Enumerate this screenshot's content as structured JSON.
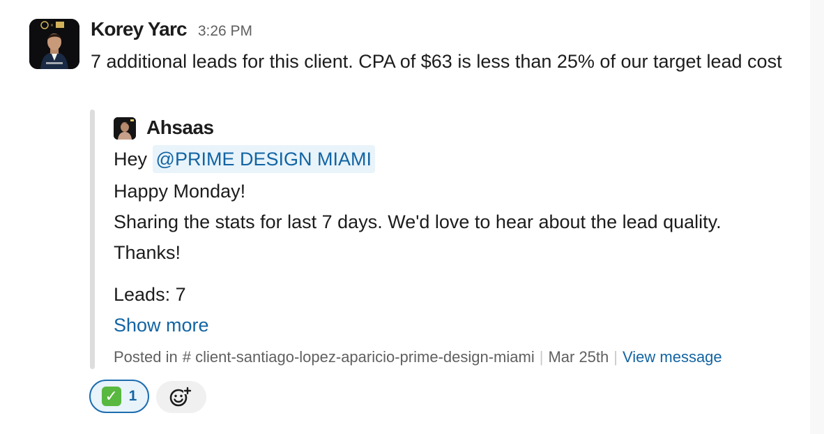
{
  "message": {
    "author": "Korey Yarc",
    "timestamp": "3:26 PM",
    "text": "7 additional leads for this client. CPA of $63 is less than 25% of our target lead cost",
    "avatar_icon": "profile-photo"
  },
  "attachment": {
    "author": "Ahsaas",
    "avatar_icon": "profile-photo",
    "greeting": "Hey",
    "mention": "@PRIME DESIGN MIAMI",
    "lines": [
      "Happy Monday!",
      "Sharing the stats for last 7 days. We'd love to hear about the lead quality.",
      "Thanks!"
    ],
    "leads_line": "Leads: 7",
    "show_more": "Show more",
    "footer": {
      "posted_in": "Posted in",
      "channel": "# client-santiago-lopez-aparicio-prime-design-miami",
      "date": "Mar 25th",
      "view_message": "View message"
    }
  },
  "reactions": [
    {
      "emoji": "✅",
      "emoji_name": "white-check-mark",
      "count": "1"
    }
  ],
  "add_reaction_icon": "emoji-add-icon",
  "colors": {
    "link": "#1264a3",
    "mention_bg": "#e8f3fa",
    "reaction_border": "#1d6db0",
    "check_green": "#59b83f",
    "quote_bar": "#dddddd"
  }
}
